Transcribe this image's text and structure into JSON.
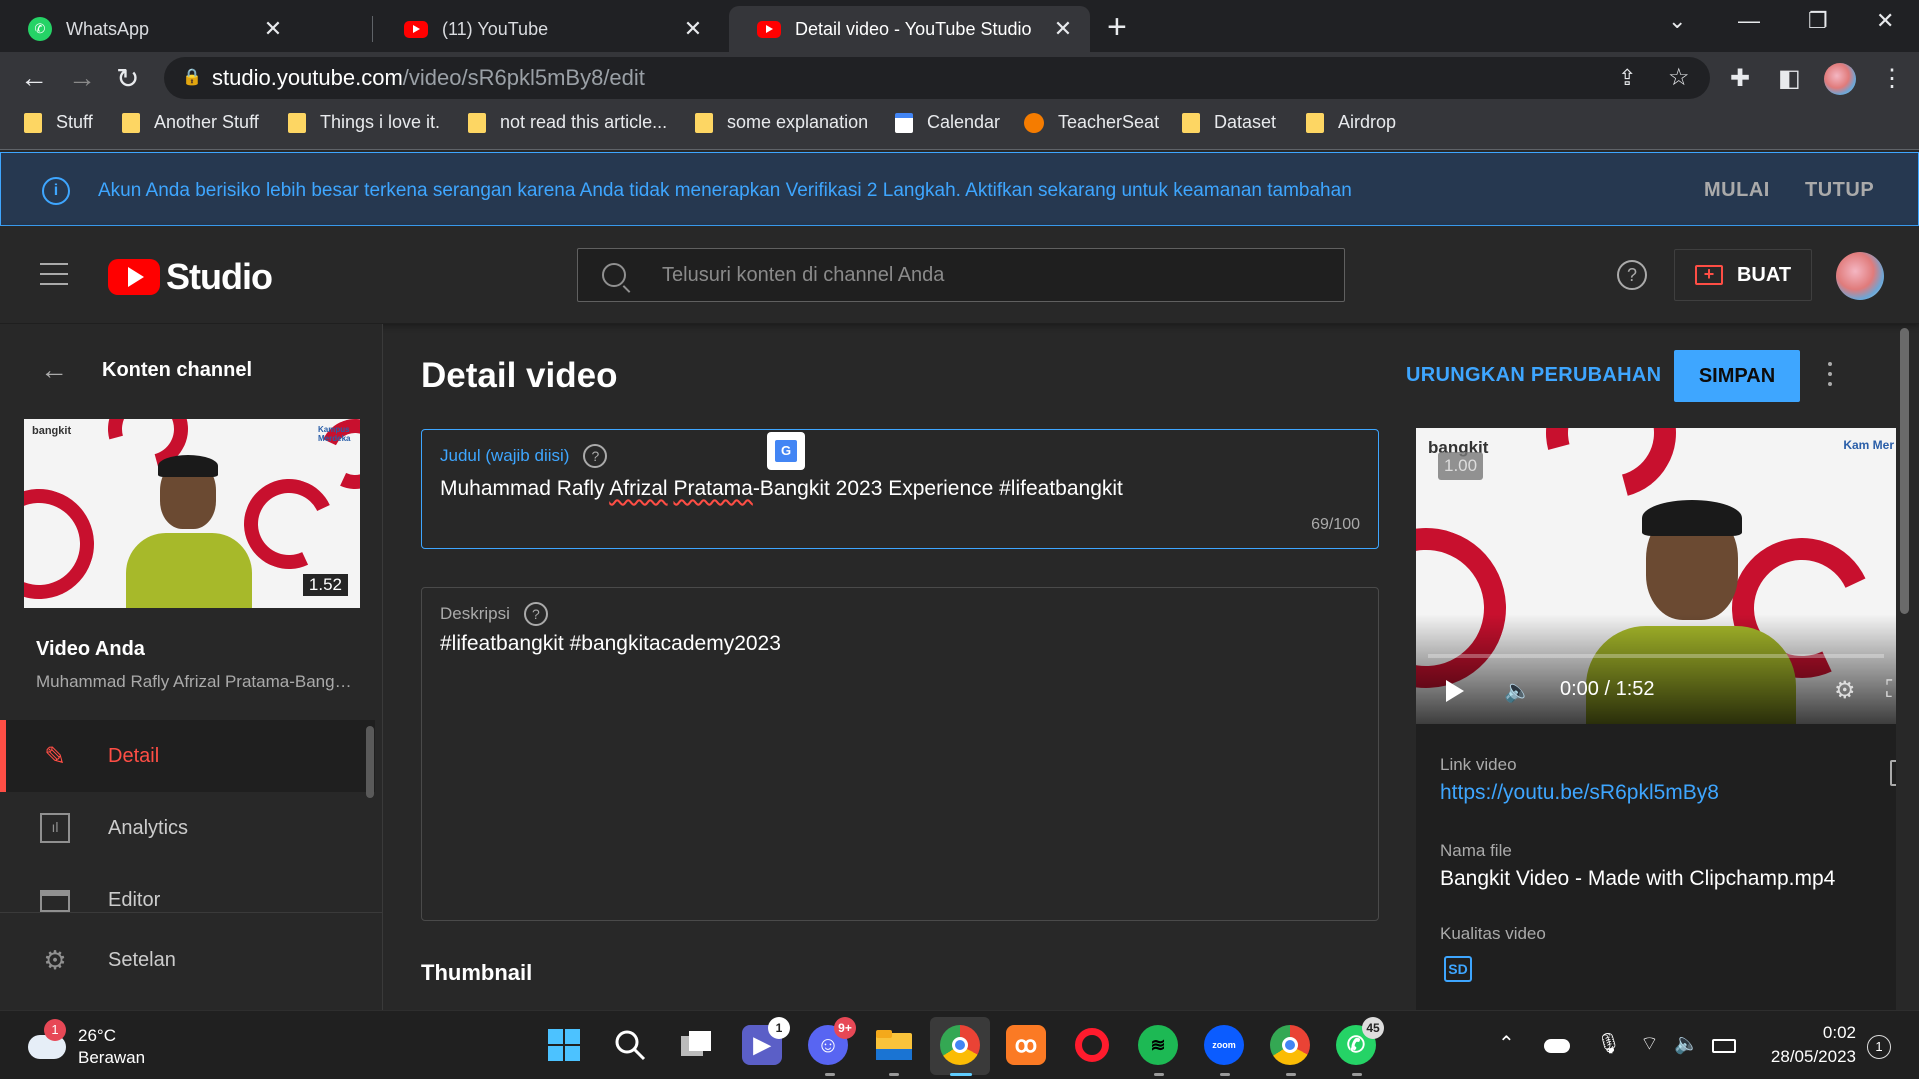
{
  "browser": {
    "tabs": [
      {
        "title": "WhatsApp",
        "favicon": "whatsapp-icon",
        "color": "#25d366"
      },
      {
        "title": "(11) YouTube",
        "favicon": "youtube-icon",
        "color": "#ff0000"
      },
      {
        "title": "Detail video - YouTube Studio",
        "favicon": "youtube-icon",
        "color": "#ff0000"
      }
    ],
    "url_host": "studio.youtube.com",
    "url_path": "/video/sR6pkl5mBy8/edit",
    "bookmarks": [
      {
        "label": "Stuff",
        "icon": "folder-icon"
      },
      {
        "label": "Another Stuff",
        "icon": "folder-icon"
      },
      {
        "label": "Things i love it.",
        "icon": "folder-icon"
      },
      {
        "label": "not read this article...",
        "icon": "folder-icon"
      },
      {
        "label": "some explanation",
        "icon": "folder-icon"
      },
      {
        "label": "Calendar",
        "icon": "calendar-icon"
      },
      {
        "label": "TeacherSeat",
        "icon": "hexagon-icon"
      },
      {
        "label": "Dataset",
        "icon": "folder-icon"
      },
      {
        "label": "Airdrop",
        "icon": "folder-icon"
      }
    ]
  },
  "alert": {
    "message": "Akun Anda berisiko lebih besar terkena serangan karena Anda tidak menerapkan Verifikasi 2 Langkah. Aktifkan sekarang untuk keamanan tambahan",
    "start_label": "MULAI",
    "close_label": "TUTUP"
  },
  "header": {
    "logo_text": "Studio",
    "search_placeholder": "Telusuri konten di channel Anda",
    "help": "?",
    "create_label": "BUAT"
  },
  "sidebar": {
    "back_label": "Konten channel",
    "thumb_duration": "1.52",
    "thumb_brand": "bangkit",
    "thumb_brand2": "Kampus Merdeka",
    "your_video_label": "Video Anda",
    "your_video_title": "Muhammad Rafly Afrizal Pratama-Bangkit 2023 Experience #lifeatbangkit",
    "items": [
      {
        "label": "Detail",
        "icon": "pencil-icon",
        "active": true
      },
      {
        "label": "Analytics",
        "icon": "analytics-icon",
        "active": false
      },
      {
        "label": "Editor",
        "icon": "editor-icon",
        "active": false
      },
      {
        "label": "Setelan",
        "icon": "gear-icon",
        "active": false
      }
    ]
  },
  "main": {
    "page_title": "Detail video",
    "undo_label": "URUNGKAN PERUBAHAN",
    "save_label": "SIMPAN",
    "title_field": {
      "label": "Judul (wajib diisi)",
      "value_parts": [
        "Muhammad Rafly ",
        "Afrizal",
        " ",
        "Pratama",
        "-Bangkit 2023 Experience #lifeatbangkit"
      ],
      "counter": "69/100"
    },
    "description_field": {
      "label": "Deskripsi",
      "value": "#lifeatbangkit #bangkitacademy2023"
    },
    "thumbnail_heading": "Thumbnail"
  },
  "side_panel": {
    "speed": "1.00",
    "brand": "bangkit",
    "brand2": "Kam Mer",
    "time": "0:00 / 1:52",
    "link_label": "Link video",
    "link_value": "https://youtu.be/sR6pkl5mBy8",
    "file_label": "Nama file",
    "file_value": "Bangkit Video - Made with Clipchamp.mp4",
    "quality_label": "Kualitas video",
    "quality_badge": "SD"
  },
  "taskbar": {
    "weather_temp": "26°C",
    "weather_desc": "Berawan",
    "weather_badge": "1",
    "apps": [
      {
        "name": "start-icon",
        "badge": ""
      },
      {
        "name": "search-icon",
        "badge": ""
      },
      {
        "name": "task-view-icon",
        "badge": ""
      },
      {
        "name": "teams-icon",
        "badge": "1"
      },
      {
        "name": "discord-icon",
        "badge": "9+"
      },
      {
        "name": "file-explorer-icon",
        "badge": ""
      },
      {
        "name": "chrome-icon",
        "badge": ""
      },
      {
        "name": "xampp-icon",
        "badge": ""
      },
      {
        "name": "opera-icon",
        "badge": ""
      },
      {
        "name": "spotify-icon",
        "badge": ""
      },
      {
        "name": "zoom-icon",
        "badge": ""
      },
      {
        "name": "chrome-profile-icon",
        "badge": ""
      },
      {
        "name": "whatsapp-icon",
        "badge": "45"
      }
    ],
    "time": "0:02",
    "date": "28/05/2023",
    "notifications": "1"
  },
  "colors": {
    "accent_blue": "#3ea6ff",
    "youtube_red": "#ff0000",
    "active_red": "#ff4e45",
    "background": "#282828"
  }
}
